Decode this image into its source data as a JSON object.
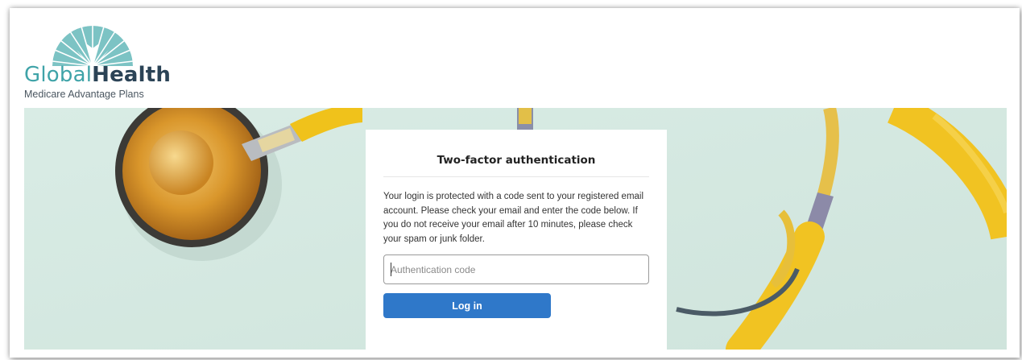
{
  "brand": {
    "name_part1": "Global",
    "name_part2": "Health",
    "tagline": "Medicare Advantage Plans",
    "colors": {
      "teal": "#3fa3a8",
      "navy": "#2b4356"
    }
  },
  "hero": {
    "image": "stethoscope-background",
    "background_color": "#d6e9e2"
  },
  "dialog": {
    "title": "Two-factor authentication",
    "message": "Your login is protected with a code sent to your registered email account. Please check your email and enter the code below. If you do not receive your email after 10 minutes, please check your spam or junk folder.",
    "input": {
      "placeholder": "Authentication code",
      "value": ""
    },
    "login_button": "Log in",
    "button_color": "#2f78c9"
  }
}
